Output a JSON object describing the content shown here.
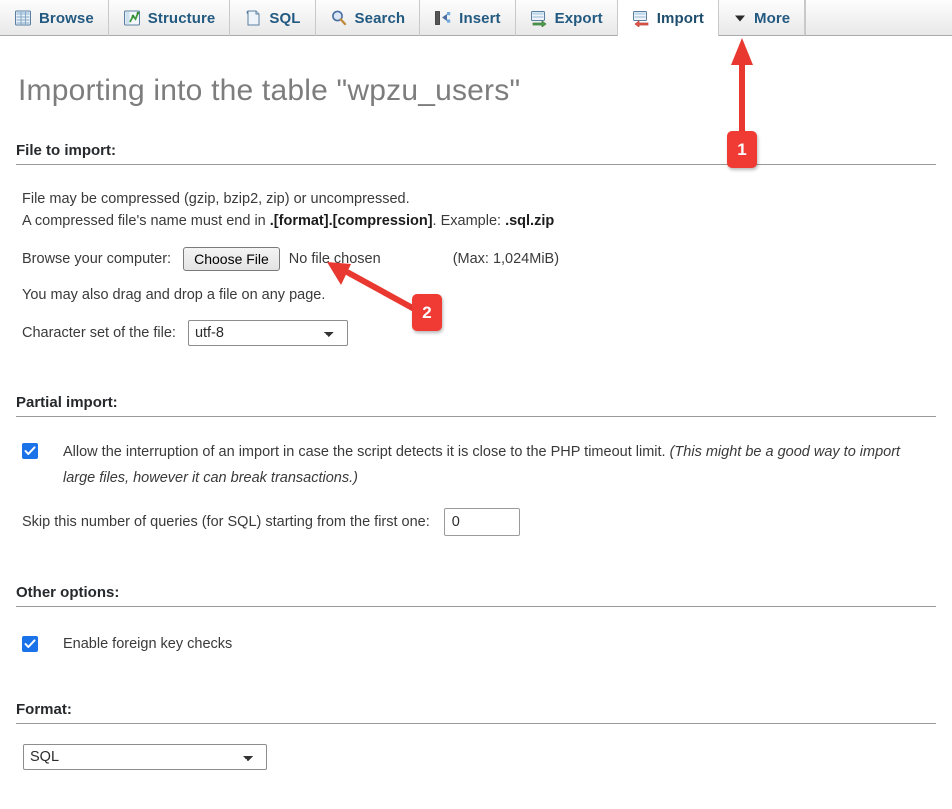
{
  "tabs": [
    {
      "label": "Browse",
      "icon": "browse-table-icon",
      "active": false
    },
    {
      "label": "Structure",
      "icon": "structure-icon",
      "active": false
    },
    {
      "label": "SQL",
      "icon": "sql-page-icon",
      "active": false
    },
    {
      "label": "Search",
      "icon": "magnifier-icon",
      "active": false
    },
    {
      "label": "Insert",
      "icon": "insert-row-icon",
      "active": false
    },
    {
      "label": "Export",
      "icon": "export-arrow-icon",
      "active": false
    },
    {
      "label": "Import",
      "icon": "import-arrow-icon",
      "active": true
    },
    {
      "label": "More",
      "icon": "chevron-down-icon",
      "active": false
    }
  ],
  "page": {
    "title": "Importing into the table \"wpzu_users\""
  },
  "file_section": {
    "heading": "File to import:",
    "line1": "File may be compressed (gzip, bzip2, zip) or uncompressed.",
    "line2_prefix": "A compressed file's name must end in ",
    "line2_bold1": ".[format].[compression]",
    "line2_mid": ". Example: ",
    "line2_bold2": ".sql.zip",
    "browse_label": "Browse your computer:",
    "choose_file_button": "Choose File",
    "file_status": "No file chosen",
    "max_note": "(Max: 1,024MiB)",
    "drag_drop_note": "You may also drag and drop a file on any page.",
    "charset_label": "Character set of the file:",
    "charset_value": "utf-8",
    "charset_options": [
      "utf-8"
    ]
  },
  "partial_section": {
    "heading": "Partial import:",
    "allow_interrupt_text": "Allow the interruption of an import in case the script detects it is close to the PHP timeout limit. ",
    "allow_interrupt_italic": "(This might be a good way to import large files, however it can break transactions.)",
    "allow_interrupt_checked": true,
    "skip_label": "Skip this number of queries (for SQL) starting from the first one:",
    "skip_value": "0"
  },
  "other_section": {
    "heading": "Other options:",
    "fk_label": "Enable foreign key checks",
    "fk_checked": true
  },
  "format_section": {
    "heading": "Format:",
    "value": "SQL",
    "options": [
      "SQL"
    ]
  },
  "annotations": [
    {
      "number": "1",
      "color": "#ef3b33",
      "points_at": "import-tab",
      "direction": "up"
    },
    {
      "number": "2",
      "color": "#ef3b33",
      "points_at": "choose-file-button",
      "direction": "up-left"
    }
  ],
  "colors": {
    "tab_text": "#235a81",
    "title": "#7d7d7d",
    "accent_red": "#ef3b33",
    "checkbox_blue": "#1a73e8"
  }
}
